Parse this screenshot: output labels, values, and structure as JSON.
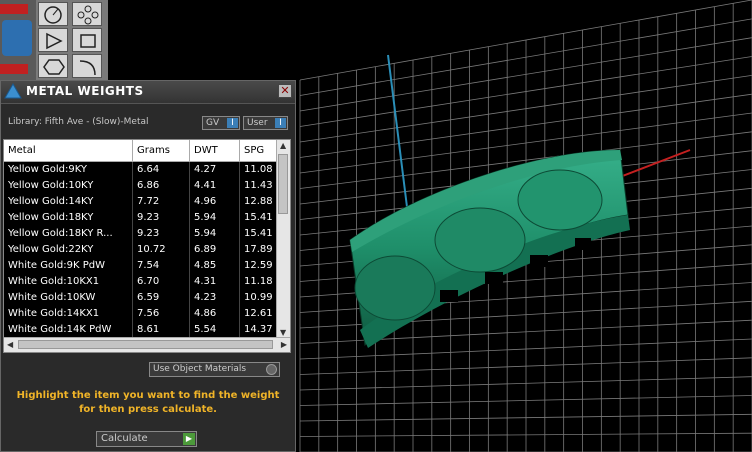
{
  "panel": {
    "title": "METAL WEIGHTS",
    "close_label": "✕",
    "library": "Library: Fifth Ave - (Slow)-Metal",
    "toggle_gv": "GV",
    "toggle_user": "User",
    "toggle_key": "I",
    "use_object_materials": "Use Object Materials",
    "hint_line1": "Highlight the item you want to find the weight",
    "hint_line2": "for then press calculate.",
    "calculate_label": "Calculate",
    "calculate_key": "▶"
  },
  "table": {
    "columns": [
      "Metal",
      "Grams",
      "DWT",
      "SPG"
    ],
    "rows": [
      [
        "Yellow Gold:9KY",
        "6.64",
        "4.27",
        "11.08"
      ],
      [
        "Yellow Gold:10KY",
        "6.86",
        "4.41",
        "11.43"
      ],
      [
        "Yellow Gold:14KY",
        "7.72",
        "4.96",
        "12.88"
      ],
      [
        "Yellow Gold:18KY",
        "9.23",
        "5.94",
        "15.41"
      ],
      [
        "Yellow Gold:18KY R...",
        "9.23",
        "5.94",
        "15.41"
      ],
      [
        "Yellow Gold:22KY",
        "10.72",
        "6.89",
        "17.89"
      ],
      [
        "White Gold:9K PdW",
        "7.54",
        "4.85",
        "12.59"
      ],
      [
        "White Gold:10KX1",
        "6.70",
        "4.31",
        "11.18"
      ],
      [
        "White Gold:10KW",
        "6.59",
        "4.23",
        "10.99"
      ],
      [
        "White Gold:14KX1",
        "7.56",
        "4.86",
        "12.61"
      ],
      [
        "White Gold:14K PdW",
        "8.61",
        "5.54",
        "14.37"
      ]
    ]
  },
  "tools": [
    "curve-icon",
    "point-icon",
    "triangle-icon",
    "rectangle-icon",
    "hexagon-icon",
    "arc-icon"
  ],
  "colors": {
    "model": "#1f8f6a",
    "grid": "#7a7a7a",
    "axis_y": "#2a8fb8",
    "axis_x": "#c42020",
    "hint": "#f0b428"
  }
}
